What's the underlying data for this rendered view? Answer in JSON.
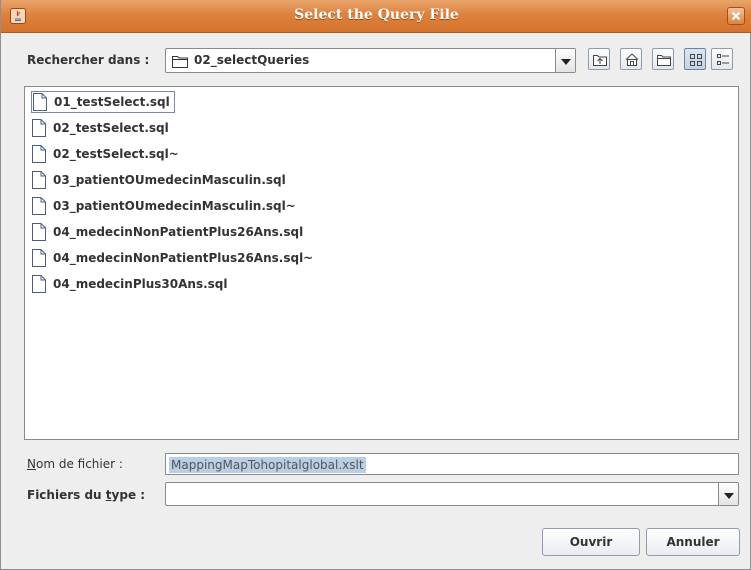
{
  "window": {
    "title": "Select the Query File"
  },
  "look_in": {
    "label": "Rechercher dans :",
    "current_folder": "02_selectQueries"
  },
  "toolbar": {
    "icons": [
      "up-folder-icon",
      "home-icon",
      "new-folder-icon",
      "list-view-icon",
      "details-view-icon"
    ]
  },
  "files": [
    {
      "name": "01_testSelect.sql",
      "selected": true
    },
    {
      "name": "02_testSelect.sql",
      "selected": false
    },
    {
      "name": "02_testSelect.sql~",
      "selected": false
    },
    {
      "name": "03_patientOUmedecinMasculin.sql",
      "selected": false
    },
    {
      "name": "03_patientOUmedecinMasculin.sql~",
      "selected": false
    },
    {
      "name": "04_medecinNonPatientPlus26Ans.sql",
      "selected": false
    },
    {
      "name": "04_medecinNonPatientPlus26Ans.sql~",
      "selected": false
    },
    {
      "name": "04_medecinPlus30Ans.sql",
      "selected": false
    }
  ],
  "filename": {
    "label_prefix": "N",
    "label_rest": "om de fichier :",
    "value": "MappingMapTohopitalglobal.xslt"
  },
  "filetype": {
    "label_prefix": "Fichiers du ",
    "label_mnemonic": "t",
    "label_rest": "ype :",
    "value": ""
  },
  "buttons": {
    "open": "Ouvrir",
    "cancel": "Annuler"
  },
  "colors": {
    "titlebar": "#dd823f",
    "selection": "#b8cfe5"
  }
}
